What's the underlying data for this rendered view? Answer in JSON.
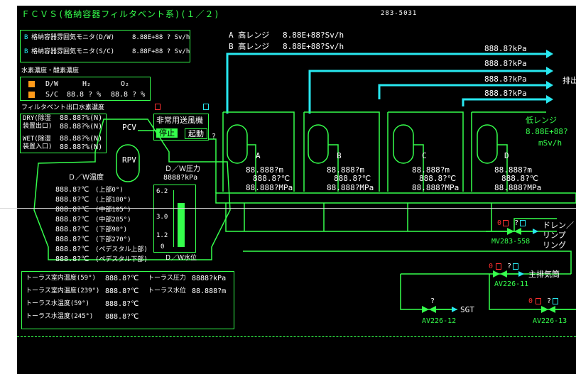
{
  "header": {
    "title": "ＦＣＶＳ(格納容器フィルタベント系)(１／２)",
    "code": "283-5031"
  },
  "monitors": {
    "a_label": "A 高レンジ",
    "a_value": "8.88E+88?Sv/h",
    "b_label": "B 高レンジ",
    "b_value": "8.88E+88?Sv/h",
    "dw_label": "格納容器雰囲気モニタ(D/W)",
    "dw_value": "8.88E+88 ? Sv/h",
    "sc_label": "格納容器雰囲気モニタ(S/C)",
    "sc_value": "8.88F+88 ? Sv/h",
    "dw_prefix": "B",
    "sc_prefix": "B"
  },
  "hydrogen": {
    "title": "水素濃度・酸素濃度",
    "h2_header": "H₂",
    "o2_header": "O₂",
    "dw_label": "D/W",
    "sc_label": "S/C",
    "sc_h2": "88.8 ? %",
    "sc_o2": "88.8 ? %"
  },
  "filter_outlet": {
    "title": "フィルタベント出口水素濃度",
    "dry_label1": "DRY(除湿",
    "dry_label2": "装置出口)",
    "wet_label1": "WET(除湿",
    "wet_label2": "装置入口)",
    "values": [
      "88.88?%(N)",
      "88.88?%(N)",
      "88.88?%(N)",
      "88.88?%(N)"
    ]
  },
  "blower": {
    "title": "非常用送風機",
    "stop_label": "停止",
    "start_label": "起動",
    "unknown": "?"
  },
  "pcv": {
    "pcv_label": "PCV",
    "rpv_label": "RPV",
    "dw_temp_title": "Ｄ／Ｗ温度",
    "temps": [
      {
        "value": "888.8?℃",
        "loc": "(上部0°)"
      },
      {
        "value": "888.8?℃",
        "loc": "(上部180°)"
      },
      {
        "value": "888.8?℃",
        "loc": "(中部105°)"
      },
      {
        "value": "888.8?℃",
        "loc": "(中部285°)"
      },
      {
        "value": "888.8?℃",
        "loc": "(下部90°)"
      },
      {
        "value": "888.8?℃",
        "loc": "(下部270°)"
      },
      {
        "value": "888.8?℃",
        "loc": "(ペデスタル上部)"
      },
      {
        "value": "888.8?℃",
        "loc": "(ペデスタル下部)"
      }
    ],
    "dw_pressure_title": "Ｄ／Ｗ圧力",
    "dw_pressure_value": "8888?kPa",
    "dw_level_title": "Ｄ／Ｗ水位",
    "level_ticks": [
      "6.2",
      "3.0",
      "1.2",
      "0"
    ],
    "level_fraction": 0.78
  },
  "torus": {
    "rows": [
      {
        "label": "トーラス室内温度(59°)",
        "value": "888.8?℃",
        "label2": "トーラス圧力",
        "value2": "8888?kPa"
      },
      {
        "label": "トーラス室内温度(239°)",
        "value": "888.8?℃",
        "label2": "トーラス水位",
        "value2": "88.888?m"
      },
      {
        "label": "トーラス水温度(59°)",
        "value": "888.8?℃",
        "label2": "",
        "value2": ""
      },
      {
        "label": "トーラス水温度(245°)",
        "value": "888.8?℃",
        "label2": "",
        "value2": ""
      }
    ]
  },
  "vessels": [
    {
      "name": "A",
      "level": "88.888?m",
      "temp": "888.8?℃",
      "pressure": "88.888?MPa"
    },
    {
      "name": "B",
      "level": "88.888?m",
      "temp": "888.8?℃",
      "pressure": "88.888?MPa"
    },
    {
      "name": "C",
      "level": "88.888?m",
      "temp": "888.8?℃",
      "pressure": "88.888?MPa"
    },
    {
      "name": "D",
      "level": "88.888?m",
      "temp": "888.8?℃",
      "pressure": "88.888?MPa"
    }
  ],
  "exhaust": {
    "pressures": [
      "888.8?kPa",
      "888.8?kPa",
      "888.8?kPa",
      "888.8?kPa"
    ],
    "label": "排出",
    "low_range_label": "低レンジ",
    "low_range_value": "8.88E+88?",
    "low_range_unit": "mSv/h"
  },
  "valves": {
    "mv_name": "MV283-558",
    "mv_dest1": "ドレン／",
    "mv_dest2": "リンプ",
    "mv_dest3": "リング",
    "av11_name": "AV226-11",
    "av11_dest": "主排気筒",
    "av12_name": "AV226-12",
    "av12_dest": "SGT",
    "av13_name": "AV226-13",
    "q": "?",
    "o": "O",
    "zero": "0"
  }
}
